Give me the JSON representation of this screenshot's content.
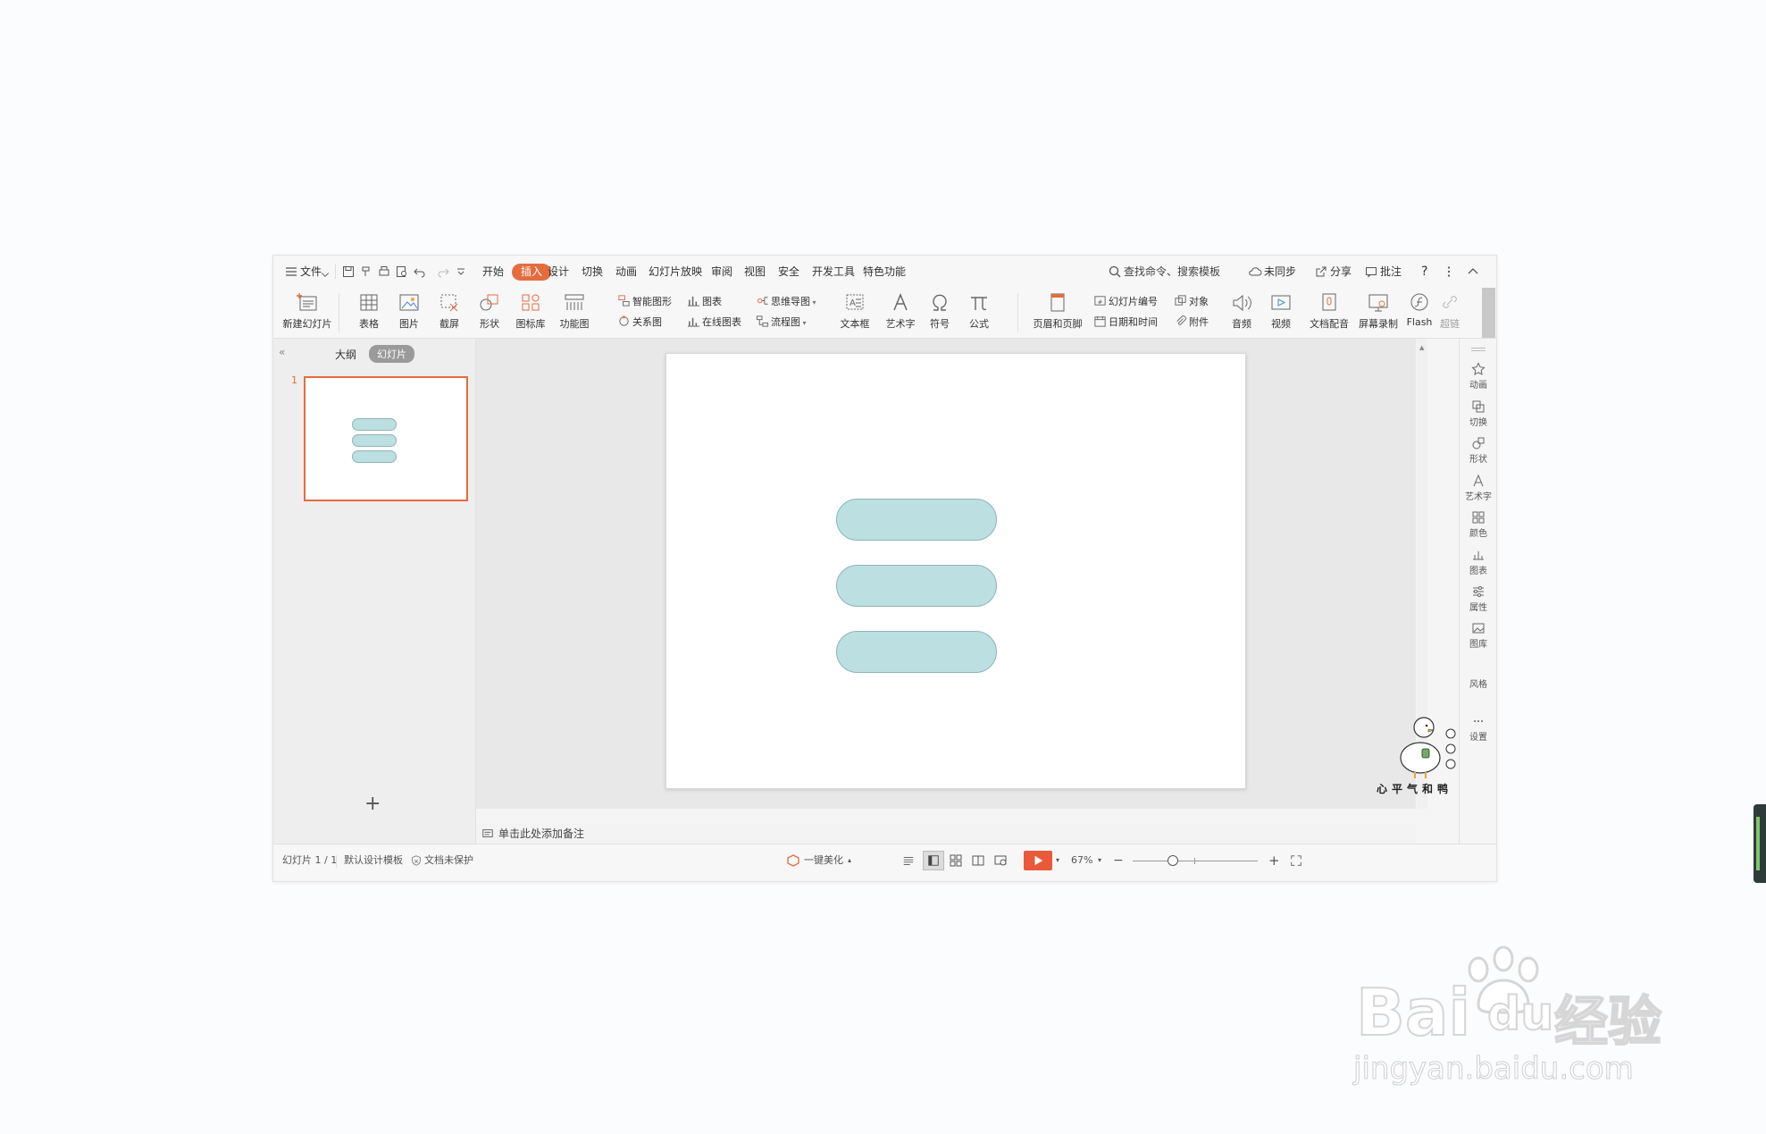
{
  "menubar": {
    "file_label": "文件",
    "tabs": [
      "开始",
      "插入",
      "设计",
      "切换",
      "动画",
      "幻灯片放映",
      "审阅",
      "视图",
      "安全",
      "开发工具",
      "特色功能"
    ],
    "active_tab": "插入",
    "search_placeholder": "查找命令、搜索模板",
    "sync_label": "未同步",
    "share_label": "分享",
    "comment_label": "批注",
    "help_label": "?"
  },
  "ribbon": {
    "new_slide": "新建幻灯片",
    "table": "表格",
    "picture": "图片",
    "screenshot": "截屏",
    "shape": "形状",
    "icon_lib": "图标库",
    "function_chart": "功能图",
    "smart_art": "智能图形",
    "chart": "图表",
    "relation_chart": "关系图",
    "online_chart": "在线图表",
    "mind_map": "思维导图",
    "flow_chart": "流程图",
    "textbox": "文本框",
    "art_text": "艺术字",
    "symbol": "符号",
    "formula": "公式",
    "header_footer": "页眉和页脚",
    "slide_number": "幻灯片编号",
    "object": "对象",
    "date_time": "日期和时间",
    "attachment": "附件",
    "audio": "音频",
    "video": "视频",
    "doc_voice": "文档配音",
    "screen_record": "屏幕录制",
    "flash": "Flash",
    "hyperlink": "超链"
  },
  "left_panel": {
    "outline_tab": "大纲",
    "slides_tab": "幻灯片",
    "slide_number": "1",
    "add_symbol": "+"
  },
  "notes": {
    "placeholder": "单击此处添加备注"
  },
  "right_panel": {
    "items": [
      "动画",
      "切换",
      "形状",
      "艺术字",
      "颜色",
      "图表",
      "属性",
      "图库",
      "风格",
      "设置"
    ]
  },
  "status": {
    "slide_counter": "幻灯片 1 / 1",
    "template": "默认设计模板",
    "protection": "文档未保护",
    "beautify": "一键美化",
    "zoom": "67%"
  },
  "mascot": {
    "caption": "心平气和鸭"
  },
  "watermark": {
    "logo_text": "Bai",
    "logo_text2": "du",
    "cn_text": "经验",
    "url": "jingyan.baidu.com"
  },
  "colors": {
    "accent": "#e46c3f",
    "shape_fill": "#bcdfe2",
    "shape_border": "#8fb3b7"
  }
}
